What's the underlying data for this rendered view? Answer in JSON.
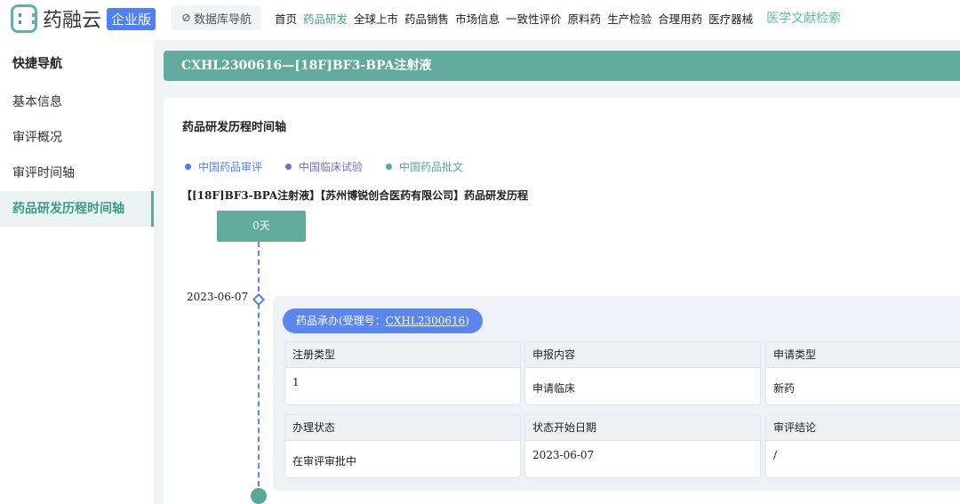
{
  "header": {
    "logo": "药融云",
    "edition": "企业版",
    "db_nav": "数据库导航",
    "nav": [
      "首页",
      "药品研发",
      "全球上市",
      "药品销售",
      "市场信息",
      "一致性评价",
      "原料药",
      "生产检验",
      "合理用药",
      "医疗器械"
    ],
    "nav_active": "药品研发",
    "literature": "医学文献检索"
  },
  "sidebar": {
    "title": "快捷导航",
    "items": [
      "基本信息",
      "审评概况",
      "审评时间轴",
      "药品研发历程时间轴"
    ]
  },
  "title": "CXHL2300616—[18F]BF3-BPA注射液",
  "section": {
    "title": "药品研发历程时间轴",
    "legend": [
      {
        "label": "中国药品审评",
        "color": "#4e7ff5"
      },
      {
        "label": "中国临床试验",
        "color": "#6d6fd6"
      },
      {
        "label": "中国药品批文",
        "color": "#5aa897"
      }
    ],
    "subtitle": "【[18F]BF3-BPA注射液】【苏州博锐创合医药有限公司】药品研发历程",
    "days": "0天",
    "event": {
      "date": "2023-06-07",
      "pill_prefix": "药品承办(受理号：",
      "pill_link": "CXHL2300616",
      "pill_suffix": ")",
      "fields": [
        {
          "k": "注册类型",
          "v": "1"
        },
        {
          "k": "申报内容",
          "v": "申请临床"
        },
        {
          "k": "申请类型",
          "v": "新药"
        },
        {
          "k": "办理状态",
          "v": "在审评审批中"
        },
        {
          "k": "状态开始日期",
          "v": "2023-06-07"
        },
        {
          "k": "审评结论",
          "v": "/"
        }
      ]
    }
  }
}
